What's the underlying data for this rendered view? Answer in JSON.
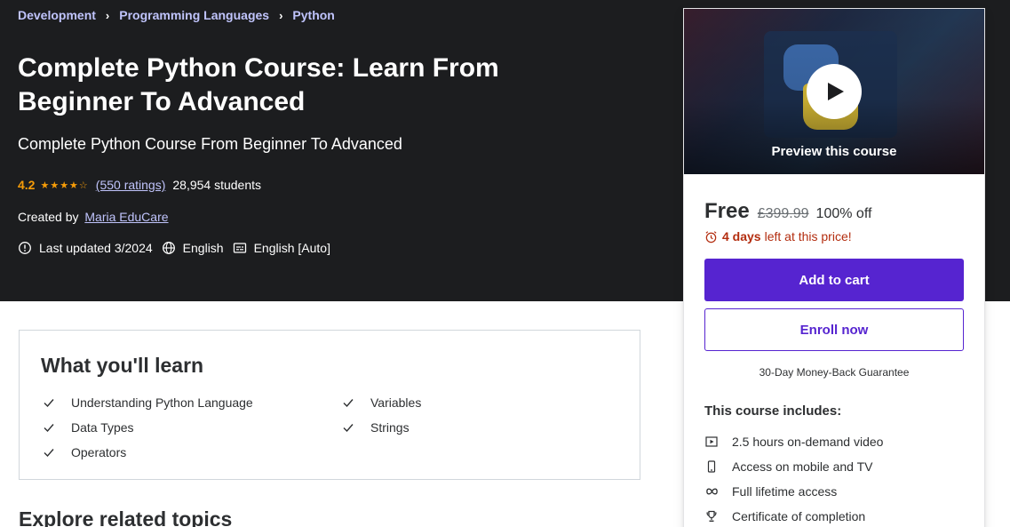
{
  "breadcrumb": [
    "Development",
    "Programming Languages",
    "Python"
  ],
  "breadcrumb_separator": "›",
  "course": {
    "title": "Complete Python Course: Learn From Beginner To Advanced",
    "subtitle": "Complete Python Course From Beginner To Advanced",
    "rating": "4.2",
    "stars_display": "★★★★☆",
    "ratings_count": "(550 ratings)",
    "students": "28,954 students",
    "created_by_label": "Created by",
    "author": "Maria EduCare",
    "last_updated": "Last updated 3/2024",
    "language": "English",
    "captions": "English [Auto]"
  },
  "sidebar": {
    "preview_label": "Preview this course",
    "price": "Free",
    "original_price": "£399.99",
    "discount": "100% off",
    "timer_days": "4 days",
    "timer_text": "left at this price!",
    "add_to_cart": "Add to cart",
    "enroll_now": "Enroll now",
    "guarantee": "30-Day Money-Back Guarantee",
    "includes_title": "This course includes:",
    "includes": [
      {
        "icon": "video-icon",
        "text": "2.5 hours on-demand video"
      },
      {
        "icon": "mobile-icon",
        "text": "Access on mobile and TV"
      },
      {
        "icon": "infinity-icon",
        "text": "Full lifetime access"
      },
      {
        "icon": "trophy-icon",
        "text": "Certificate of completion"
      }
    ]
  },
  "learn": {
    "title": "What you'll learn",
    "items": [
      "Understanding Python Language",
      "Variables",
      "Data Types",
      "Strings",
      "Operators"
    ]
  },
  "explore_title": "Explore related topics",
  "colors": {
    "hero_bg": "#1c1d1f",
    "link_purple": "#c0c4fc",
    "rating_orange": "#f69c08",
    "brand_purple": "#5624d0",
    "urgency_red": "#b32d0f"
  }
}
